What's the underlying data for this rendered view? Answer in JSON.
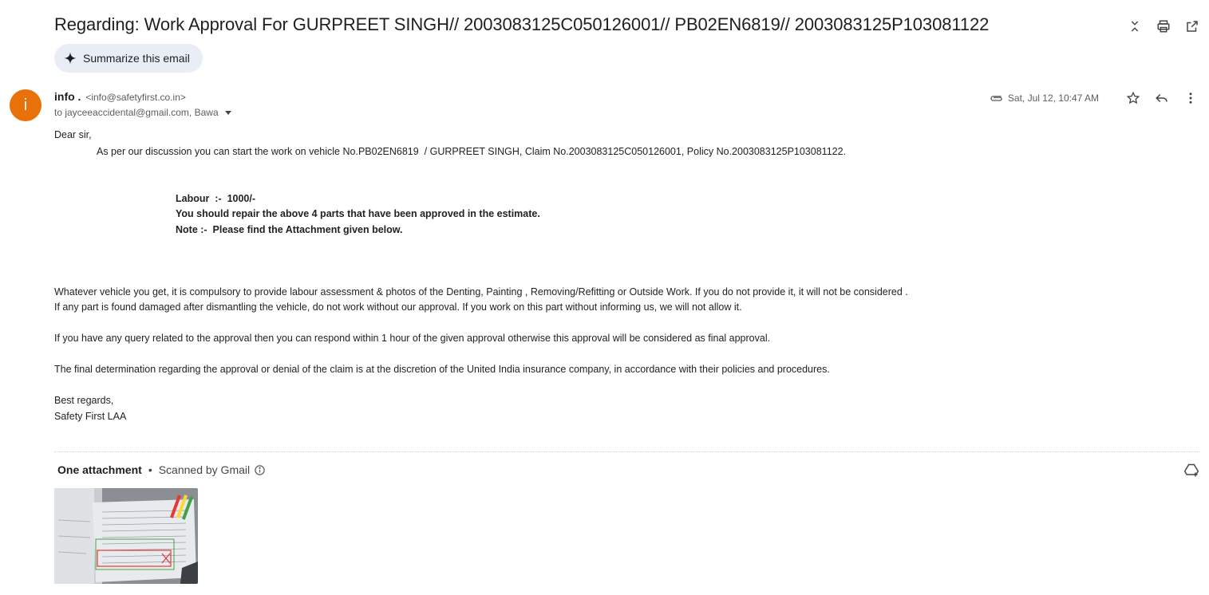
{
  "subject": "Regarding: Work Approval For GURPREET SINGH// 2003083125C050126001// PB02EN6819// 2003083125P103081122",
  "summarize_label": "Summarize this email",
  "sender": {
    "avatar_letter": "i",
    "avatar_color": "#e8710a",
    "name": "info .",
    "email": "<info@safetyfirst.co.in>",
    "recipients": "to jayceeaccidental@gmail.com, Bawa"
  },
  "date": "Sat, Jul 12, 10:47 AM",
  "icons": {
    "top": [
      "collapse-icon",
      "print-icon",
      "open-in-new-window-icon"
    ],
    "message": [
      "attachment-clip-icon",
      "star-icon",
      "reply-icon",
      "more-vert-icon"
    ],
    "attachments": [
      "info-icon",
      "add-to-drive-icon"
    ],
    "summarize": "sparkle-icon"
  },
  "body": {
    "greeting": "Dear sir,",
    "intro_prefix": "As per our discussion you can start the work on vehicle No.",
    "vehicle_no": "PB02EN6819",
    "owner_sep": "  / ",
    "owner": "GURPREET SINGH",
    "claim_text": ", Claim No.2003083125C050126001, Policy No.2003083125P103081122.",
    "labour": "Labour  :-  1000/-",
    "repair_note": "You should repair the above 4 parts that have been approved in the estimate.",
    "attachment_note": "Note :-  Please find the Attachment given below.",
    "para1_line1": "Whatever vehicle you get, it is compulsory to provide labour assessment & photos of the Denting, Painting , Removing/Refitting or Outside Work. If you do not provide it, it will not be considered .",
    "para1_line2": "If any part is found damaged after dismantling the vehicle, do not work without our approval. If you work on this part without informing us, we will not allow it.",
    "para2": "If you have any query related to the approval then you can respond within 1 hour of the given approval otherwise this approval will be considered as final approval.",
    "para3": "The final determination regarding the approval or denial of the claim is at the discretion of the United India insurance company, in accordance with their policies and procedures.",
    "closing": "Best regards,",
    "signature": "Safety First LAA"
  },
  "attachments": {
    "title": "One attachment",
    "dot": "•",
    "scanned": "Scanned by Gmail"
  }
}
